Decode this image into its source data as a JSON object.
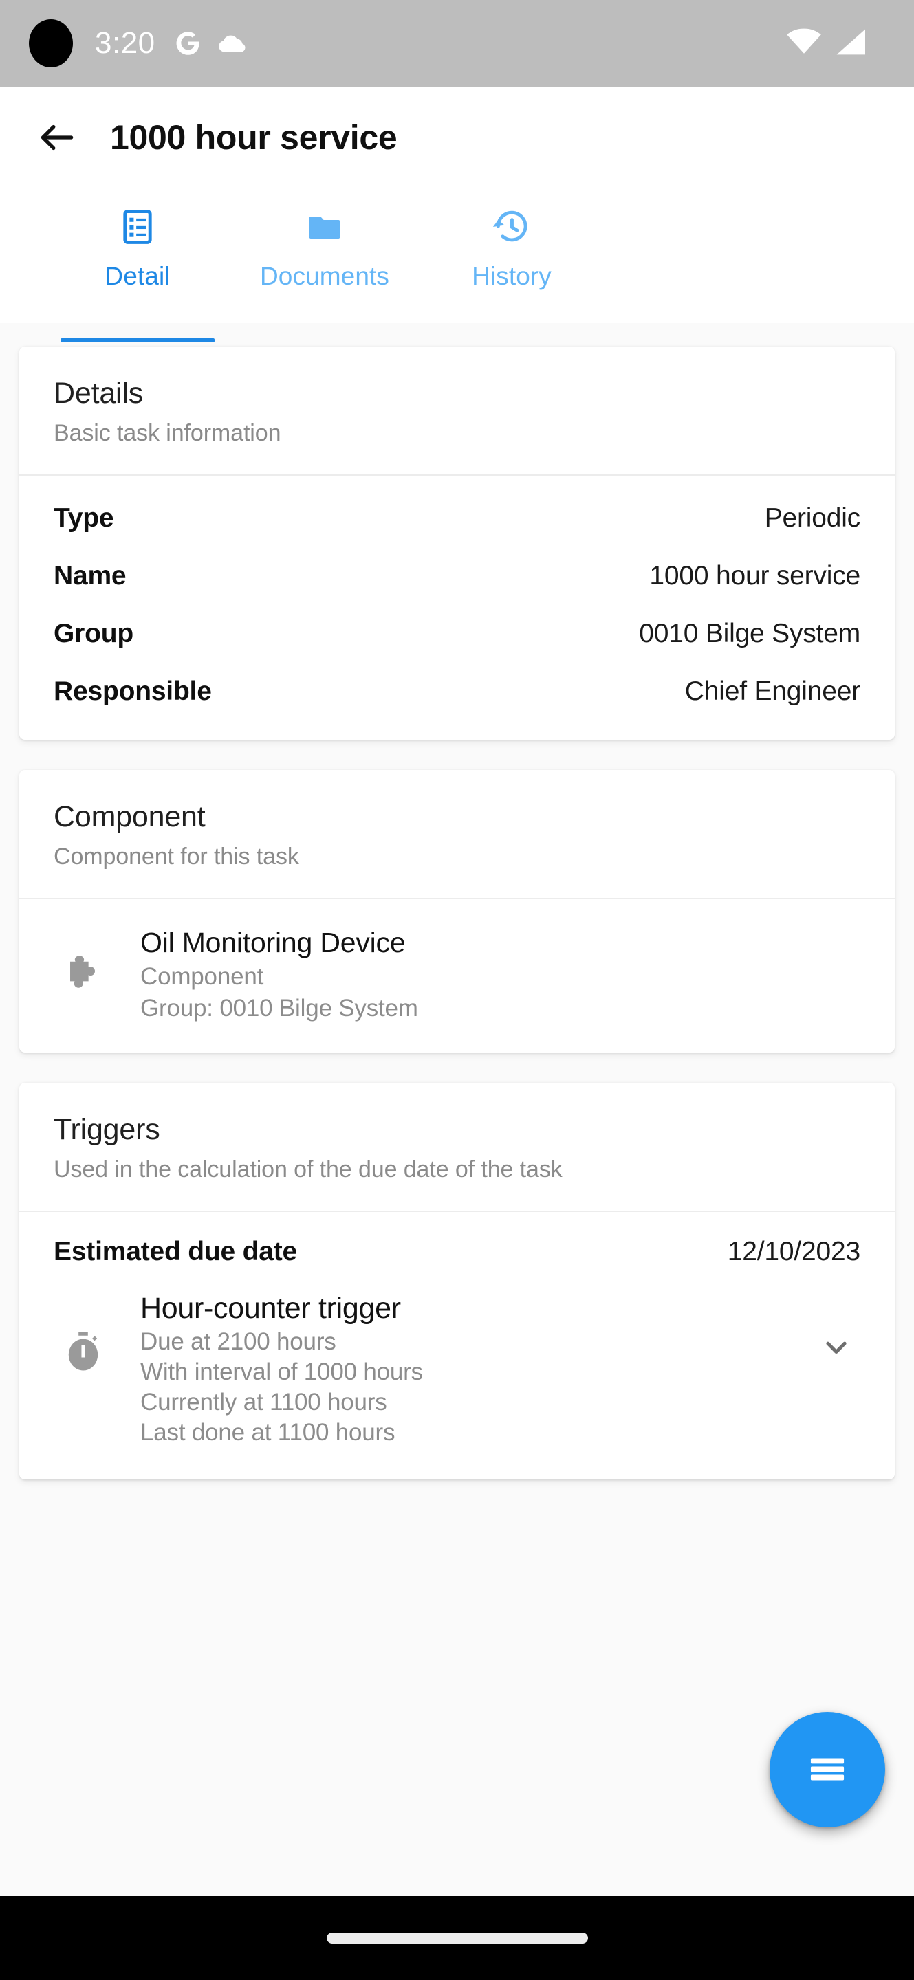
{
  "status_bar": {
    "time": "3:20",
    "icons": [
      "camera-dot",
      "google-icon",
      "cloud-icon",
      "wifi-icon",
      "cellular-signal-icon"
    ]
  },
  "app_bar": {
    "back_icon": "arrow-back-icon",
    "title": "1000 hour service"
  },
  "tabs": [
    {
      "label": "Detail",
      "icon": "list-detail-icon",
      "active": true
    },
    {
      "label": "Documents",
      "icon": "folder-icon",
      "active": false
    },
    {
      "label": "History",
      "icon": "history-clock-icon",
      "active": false
    }
  ],
  "details_card": {
    "title": "Details",
    "subtitle": "Basic task information",
    "rows": [
      {
        "key": "Type",
        "value": "Periodic"
      },
      {
        "key": "Name",
        "value": "1000 hour service"
      },
      {
        "key": "Group",
        "value": "0010 Bilge System"
      },
      {
        "key": "Responsible",
        "value": "Chief Engineer"
      }
    ]
  },
  "component_card": {
    "title": "Component",
    "subtitle": "Component for this task",
    "item": {
      "icon": "puzzle-piece-icon",
      "name": "Oil Monitoring Device",
      "type": "Component",
      "group": "Group: 0010 Bilge System"
    }
  },
  "triggers_card": {
    "title": "Triggers",
    "subtitle": "Used in the calculation of the due date of the task",
    "due_date_label": "Estimated due date",
    "due_date_value": "12/10/2023",
    "trigger": {
      "icon": "stopwatch-icon",
      "title": "Hour-counter trigger",
      "lines": [
        "Due at 2100 hours",
        "With interval of 1000 hours",
        "Currently at 1100 hours",
        "Last done at 1100 hours"
      ],
      "expand_icon": "chevron-down-icon"
    }
  },
  "fab": {
    "icon": "menu-hamburger-icon",
    "label": ""
  },
  "nav_bar": {
    "home_indicator": "home-indicator-pill"
  },
  "colors": {
    "accent": "#2196f3",
    "tab_active": "#1e88e5",
    "tab_inactive": "#64b5f6",
    "status_bar_bg": "#bdbdbd",
    "page_bg": "#fafafa",
    "card_bg": "#ffffff",
    "muted_text": "#8c8c8c"
  }
}
